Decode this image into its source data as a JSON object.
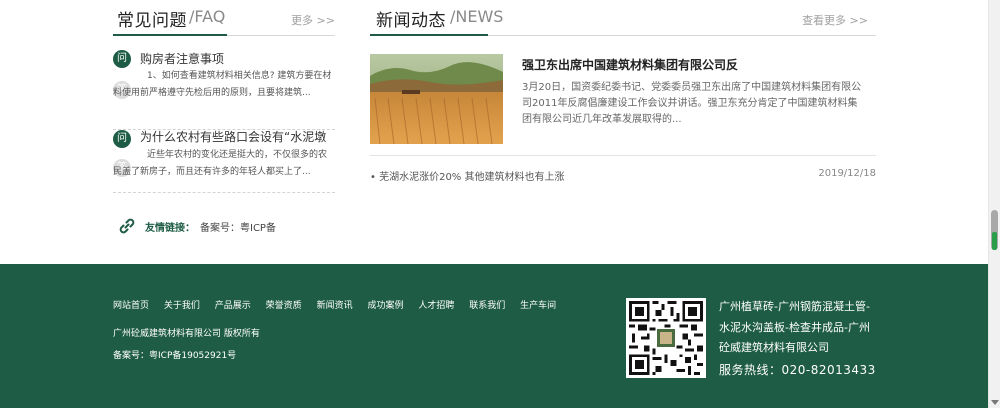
{
  "faq": {
    "title_cn": "常见问题",
    "title_en": "/FAQ",
    "more": "更多 >>",
    "q_badge": "问",
    "a_badge": "答",
    "items": [
      {
        "question": "购房者注意事项",
        "answer": "1、如何查看建筑材料相关信息? 建筑方要在材料使用前严格遵守先检后用的原则，且要将建筑..."
      },
      {
        "question": "为什么农村有些路口会设有“水泥墩",
        "answer": "近些年农村的变化还是挺大的，不仅很多的农民盖了新房子，而且还有许多的年轻人都买上了..."
      }
    ]
  },
  "friend_links": {
    "label": "友情链接：",
    "record": "备案号：粤ICP备"
  },
  "news": {
    "title_cn": "新闻动态",
    "title_en": "/NEWS",
    "more": "查看更多 >>",
    "feature": {
      "title": "强卫东出席中国建筑材料集团有限公司反",
      "summary": "3月20日，国资委纪委书记、党委委员强卫东出席了中国建筑材料集团有限公司2011年反腐倡廉建设工作会议并讲话。强卫东充分肯定了中国建筑材料集团有限公司近几年改革发展取得的..."
    },
    "list": [
      {
        "title": "• 芜湖水泥涨价20% 其他建筑材料也有上涨",
        "date": "2019/12/18"
      }
    ]
  },
  "footer": {
    "nav": [
      "网站首页",
      "关于我们",
      "产品展示",
      "荣誉资质",
      "新闻资讯",
      "成功案例",
      "人才招聘",
      "联系我们",
      "生产车间"
    ],
    "company": "广州砼威建筑材料有限公司 版权所有",
    "record": "备案号：粤ICP备19052921号",
    "slogan": "广州植草砖-广州钢筋混凝土管-水泥水沟盖板-检查井成品-广州砼威建筑材料有限公司",
    "hotline": "服务热线：020-82013433"
  },
  "colors": {
    "brand_green": "#1e5c45",
    "badge_gray": "#dcdcdc"
  }
}
